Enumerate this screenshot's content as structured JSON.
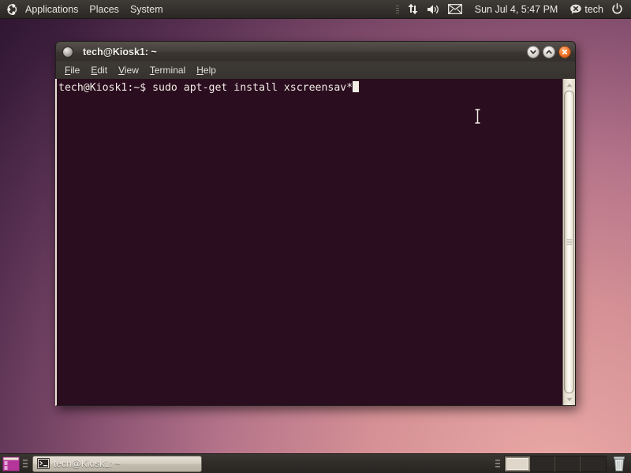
{
  "desktop": {
    "wallpaper_colors": {
      "dark": "#2d1430",
      "mid": "#8a5272",
      "light": "#e3a0a0"
    }
  },
  "top_panel": {
    "logo_icon": "ubuntu-logo-icon",
    "menus": [
      {
        "label": "Applications",
        "name": "menu-applications"
      },
      {
        "label": "Places",
        "name": "menu-places"
      },
      {
        "label": "System",
        "name": "menu-system"
      }
    ],
    "indicators": [
      {
        "name": "network-icon",
        "icon": "network-updown-icon"
      },
      {
        "name": "volume-icon",
        "icon": "speaker-icon"
      },
      {
        "name": "messaging-icon",
        "icon": "envelope-icon"
      }
    ],
    "clock": "Sun Jul  4,  5:47 PM",
    "status_icon": "chat-offline-icon",
    "username": "tech",
    "power_icon": "power-icon"
  },
  "terminal_window": {
    "title": "tech@Kiosk1: ~",
    "title_icon": "terminal-window-icon",
    "window_buttons": {
      "minimize": "minimize-icon",
      "maximize": "maximize-icon",
      "close": "close-icon"
    },
    "menubar": [
      {
        "mnemonic": "F",
        "rest": "ile",
        "name": "menu-file"
      },
      {
        "mnemonic": "E",
        "rest": "dit",
        "name": "menu-edit"
      },
      {
        "mnemonic": "V",
        "rest": "iew",
        "name": "menu-view"
      },
      {
        "mnemonic": "T",
        "rest": "erminal",
        "name": "menu-terminal"
      },
      {
        "mnemonic": "H",
        "rest": "elp",
        "name": "menu-help"
      }
    ],
    "content": {
      "background_color": "#2a0d1e",
      "foreground_color": "#f0ece4",
      "prompt": "tech@Kiosk1:~$ ",
      "command": "sudo apt-get install xscreensav*",
      "full_line": "tech@Kiosk1:~$ sudo apt-get install xscreensav*",
      "cursor": "block"
    },
    "scrollbar": {
      "up_arrow": "scroll-up-icon",
      "down_arrow": "scroll-down-icon",
      "thumb_position": "full"
    }
  },
  "bottom_panel": {
    "show_desktop_icon": "show-desktop-icon",
    "task_button": {
      "label": "tech@Kiosk1: ~",
      "icon": "terminal-icon"
    },
    "workspaces": [
      {
        "name": "workspace-1",
        "active": true
      },
      {
        "name": "workspace-2",
        "active": false
      },
      {
        "name": "workspace-3",
        "active": false
      },
      {
        "name": "workspace-4",
        "active": false
      }
    ],
    "trash_icon": "trash-icon"
  }
}
